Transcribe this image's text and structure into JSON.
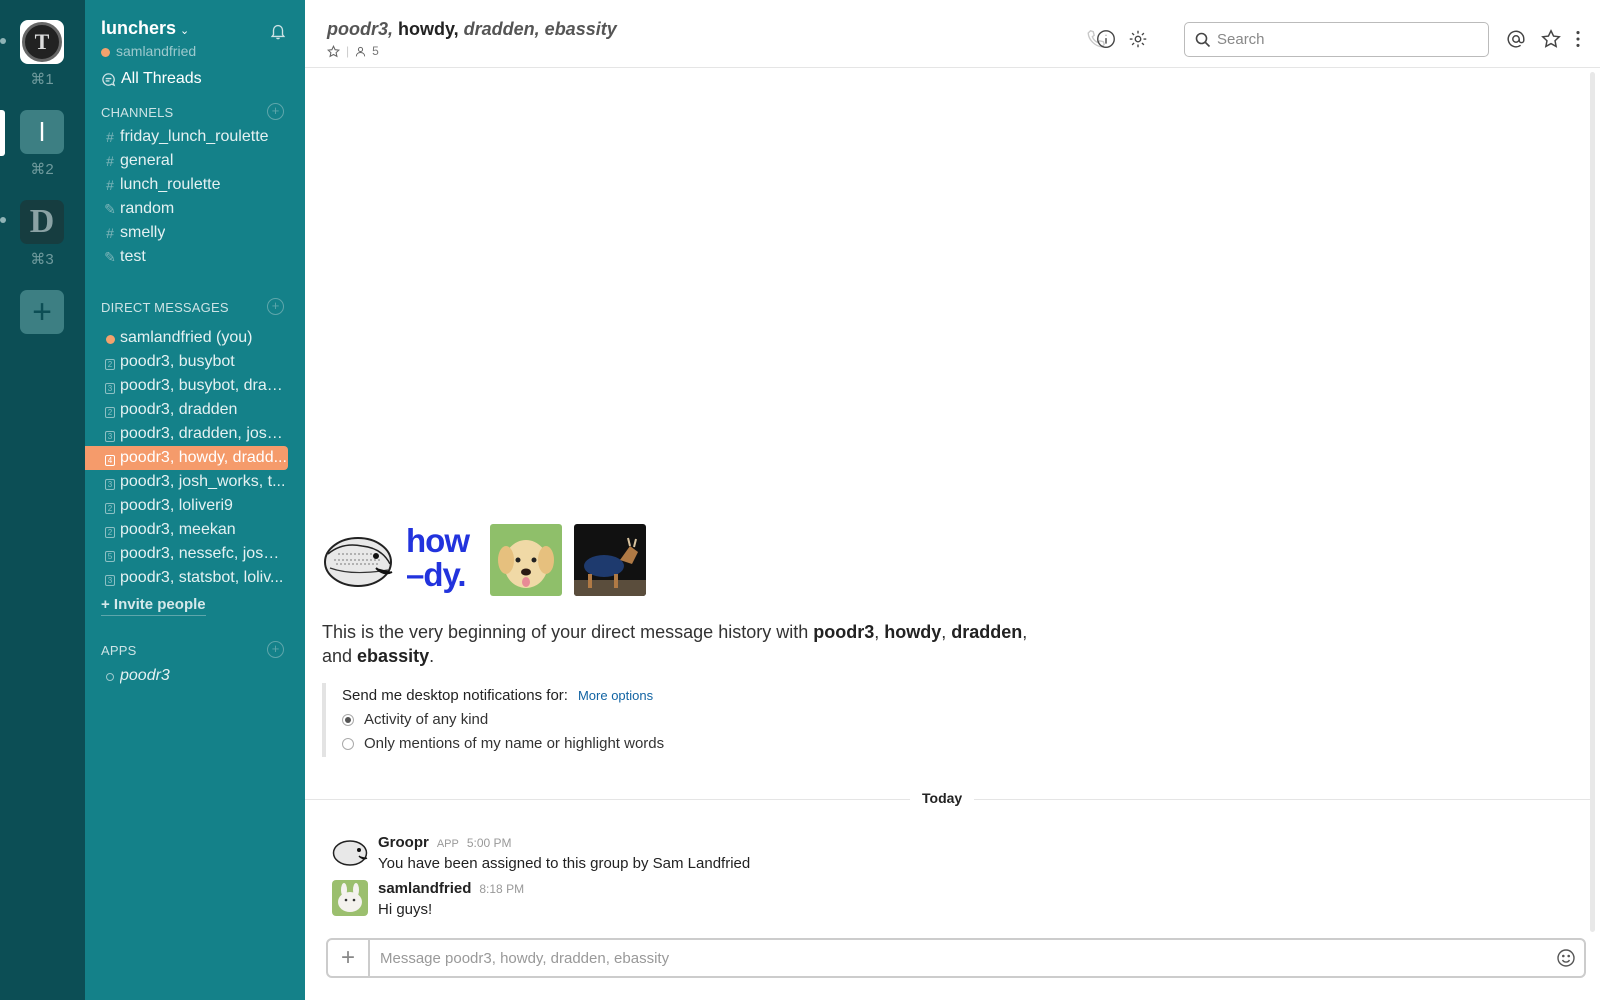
{
  "teams": [
    {
      "initial": "T",
      "shortcut": "⌘1"
    },
    {
      "initial": "l",
      "shortcut": "⌘2"
    },
    {
      "initial": "D",
      "shortcut": "⌘3"
    }
  ],
  "workspace": {
    "name": "lunchers",
    "user": "samlandfried"
  },
  "sidebar": {
    "all_threads": "All Threads",
    "channels_title": "CHANNELS",
    "channels": [
      {
        "prefix": "#",
        "name": "friday_lunch_roulette"
      },
      {
        "prefix": "#",
        "name": "general"
      },
      {
        "prefix": "#",
        "name": "lunch_roulette"
      },
      {
        "prefix": "✎",
        "name": "random"
      },
      {
        "prefix": "#",
        "name": "smelly"
      },
      {
        "prefix": "✎",
        "name": "test"
      }
    ],
    "dm_title": "DIRECT MESSAGES",
    "dms": [
      {
        "count": "",
        "name": "samlandfried (you)"
      },
      {
        "count": "2",
        "name": "poodr3, busybot"
      },
      {
        "count": "3",
        "name": "poodr3, busybot, drad..."
      },
      {
        "count": "2",
        "name": "poodr3, dradden"
      },
      {
        "count": "3",
        "name": "poodr3, dradden, josh..."
      },
      {
        "count": "4",
        "name": "poodr3, howdy, dradd..."
      },
      {
        "count": "3",
        "name": "poodr3, josh_works, t..."
      },
      {
        "count": "2",
        "name": "poodr3, loliveri9"
      },
      {
        "count": "2",
        "name": "poodr3, meekan"
      },
      {
        "count": "5",
        "name": "poodr3, nessefc, josh_..."
      },
      {
        "count": "3",
        "name": "poodr3, statsbot, loliv..."
      }
    ],
    "invite": "+ Invite people",
    "apps_title": "APPS",
    "apps": [
      {
        "name": "poodr3"
      }
    ]
  },
  "header": {
    "title_parts": [
      "poodr3, ",
      "howdy, ",
      "dradden, ebassity"
    ],
    "member_count": "5",
    "search_placeholder": "Search"
  },
  "intro": {
    "howdy_logo": "how\n–dy.",
    "text_prefix": "This is the very beginning of your direct message history with ",
    "names": [
      "poodr3",
      "howdy",
      "dradden",
      "ebassity"
    ],
    "sep1": ", ",
    "sep2": ", ",
    "sep3": ", and ",
    "suffix": ".",
    "notif_title": "Send me desktop notifications for:",
    "more_options": "More options",
    "options": [
      "Activity of any kind",
      "Only mentions of my name or highlight words"
    ],
    "selected_option": "Activity of any kind"
  },
  "divider": "Today",
  "messages": [
    {
      "sender": "Groopr",
      "badge": "APP",
      "time": "5:00 PM",
      "text": "You have been assigned to this group by Sam Landfried"
    },
    {
      "sender": "samlandfried",
      "badge": "",
      "time": "8:18 PM",
      "text": "Hi guys!"
    }
  ],
  "composer": {
    "placeholder": "Message poodr3, howdy, dradden, ebassity"
  },
  "colors": {
    "sidebar": "#148189",
    "teams": "#0c4e55",
    "active_item": "#f59b6b",
    "link": "#1264a3"
  }
}
